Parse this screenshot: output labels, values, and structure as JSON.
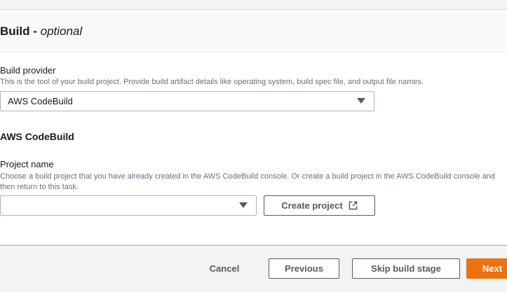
{
  "build_section": {
    "title": "Build - ",
    "title_optional": "optional",
    "build_provider": {
      "label": "Build provider",
      "description": "This is the tool of your build project. Provide build artifact details like operating system, build spec file, and output file names.",
      "selected_value": "AWS CodeBuild"
    },
    "codebuild": {
      "heading": "AWS CodeBuild",
      "project_name": {
        "label": "Project name",
        "description": "Choose a build project that you have already created in the AWS CodeBuild console. Or create a build project in the AWS CodeBuild console and then return to this task.",
        "selected_value": ""
      },
      "create_project_label": "Create project"
    }
  },
  "footer": {
    "cancel_label": "Cancel",
    "previous_label": "Previous",
    "skip_label": "Skip build stage",
    "next_label": "Next"
  },
  "colors": {
    "primary": "#ec7211",
    "text": "#16191f",
    "muted": "#687078",
    "border": "#aab7b8"
  },
  "icons": {
    "dropdown": "caret-down-icon",
    "external": "external-link-icon"
  }
}
